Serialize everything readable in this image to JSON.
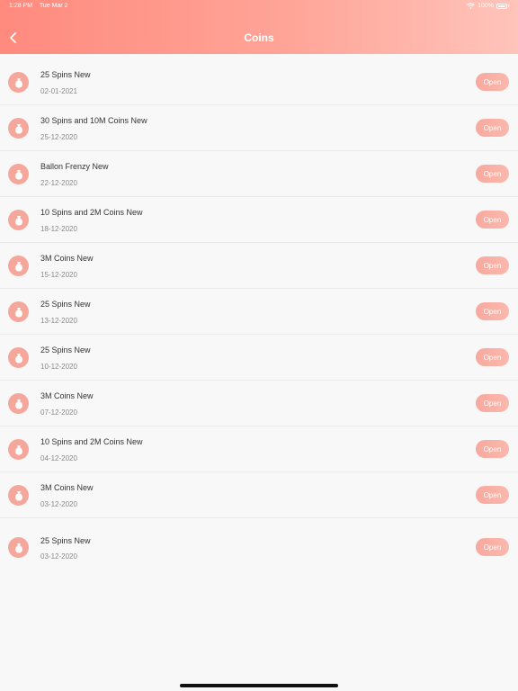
{
  "status_bar": {
    "time": "1:28 PM",
    "date": "Tue Mar 2",
    "battery": "100%"
  },
  "nav": {
    "title": "Coins"
  },
  "colors": {
    "accent": "#ff8a7e",
    "icon_bg": "#f6a79c",
    "background": "#f8f8f8"
  },
  "items": [
    {
      "title": "25 Spins New",
      "date": "02-01-2021",
      "action": "Open",
      "icon": "money-bag-icon"
    },
    {
      "title": "30 Spins and 10M Coins New",
      "date": "25-12-2020",
      "action": "Open",
      "icon": "money-bag-icon"
    },
    {
      "title": "Ballon Frenzy New",
      "date": "22-12-2020",
      "action": "Open",
      "icon": "money-bag-icon"
    },
    {
      "title": "10 Spins and 2M Coins New",
      "date": "18-12-2020",
      "action": "Open",
      "icon": "money-bag-icon"
    },
    {
      "title": "3M Coins New",
      "date": "15-12-2020",
      "action": "Open",
      "icon": "money-bag-icon"
    },
    {
      "title": "25 Spins New",
      "date": "13-12-2020",
      "action": "Open",
      "icon": "money-bag-icon"
    },
    {
      "title": "25 Spins New",
      "date": "10-12-2020",
      "action": "Open",
      "icon": "money-bag-icon"
    },
    {
      "title": "3M Coins New",
      "date": "07-12-2020",
      "action": "Open",
      "icon": "money-bag-icon"
    },
    {
      "title": "10 Spins and 2M Coins New",
      "date": "04-12-2020",
      "action": "Open",
      "icon": "money-bag-icon"
    },
    {
      "title": "3M Coins New",
      "date": "03-12-2020",
      "action": "Open",
      "icon": "money-bag-icon"
    },
    {
      "title": "25 Spins New",
      "date": "03-12-2020",
      "action": "Open",
      "icon": "money-bag-icon"
    }
  ]
}
